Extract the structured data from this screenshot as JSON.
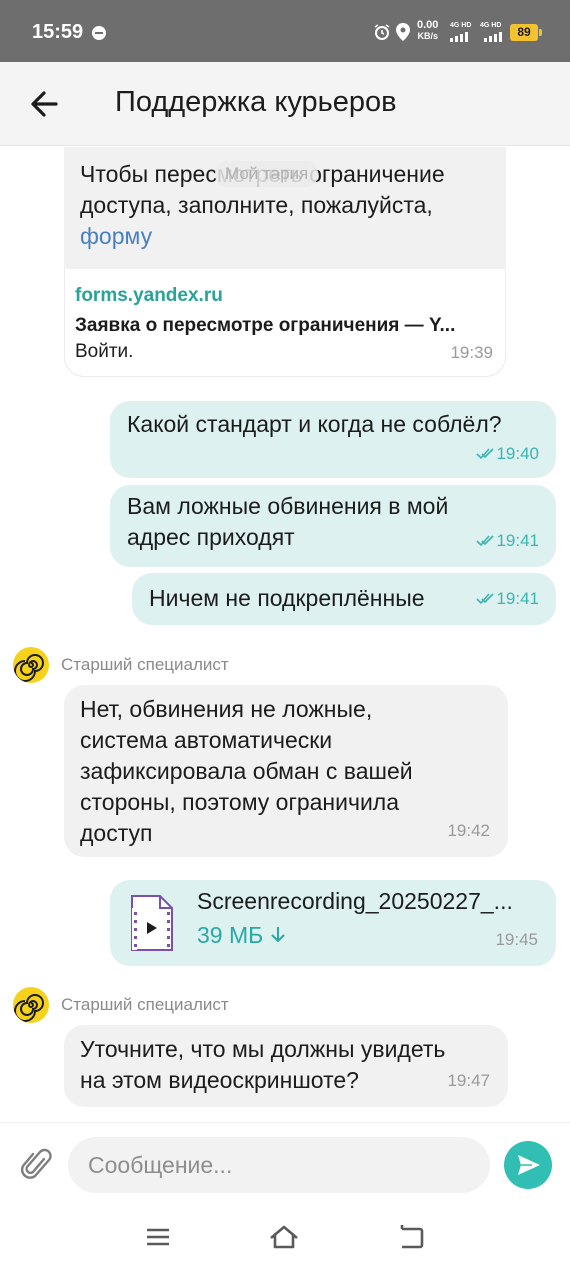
{
  "status_bar": {
    "time": "15:59",
    "speed_value": "0.00",
    "speed_unit": "KB/s",
    "network_1": "4G HD",
    "network_2": "4G HD",
    "battery": "89"
  },
  "header": {
    "title": "Поддержка курьеров"
  },
  "date_chip": "Мой тария",
  "messages": [
    {
      "direction": "incoming",
      "text_lines": [
        "Чтобы пересмотреть ограничение",
        "доступа, заполните, пожалуйста,"
      ],
      "link_word": "форму",
      "link_preview": {
        "domain": "forms.yandex.ru",
        "title": "Заявка о пересмотре ограничения — Y...",
        "description": "Войти.",
        "time": "19:39"
      }
    },
    {
      "direction": "outgoing",
      "text_lines": [
        "Какой стандарт и когда не соблёл?"
      ],
      "time": "19:40"
    },
    {
      "direction": "outgoing",
      "text_lines": [
        "Вам ложные обвинения в мой",
        "адрес приходят"
      ],
      "time": "19:41"
    },
    {
      "direction": "outgoing",
      "text_lines": [
        "Ничем не подкреплённые"
      ],
      "time": "19:41"
    },
    {
      "direction": "incoming",
      "sender": "Старший специалист",
      "text_lines": [
        "Нет, обвинения не ложные,",
        "система автоматически",
        "зафиксировала обман с вашей",
        "стороны, поэтому ограничила",
        "доступ"
      ],
      "time": "19:42"
    },
    {
      "direction": "outgoing",
      "file": {
        "name": "Screenrecording_20250227_...",
        "size": "39 МБ",
        "icon": "video-file-icon"
      },
      "time": "19:45"
    },
    {
      "direction": "incoming",
      "sender": "Старший специалист",
      "text_lines": [
        "Уточните, что мы должны увидеть",
        "на этом видеоскриншоте?"
      ],
      "time": "19:47"
    }
  ],
  "composer": {
    "placeholder": "Сообщение..."
  },
  "colors": {
    "accent": "#32bfb3",
    "outgoing_bubble": "#ddf1f1",
    "incoming_bubble": "#f1f1f1",
    "avatar": "#f7d21a"
  }
}
